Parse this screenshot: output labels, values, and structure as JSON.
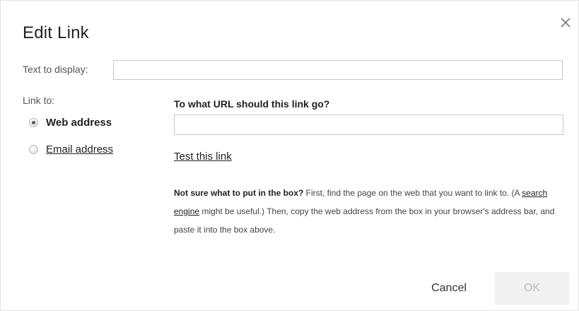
{
  "dialog": {
    "title": "Edit Link",
    "close_icon": "close-icon"
  },
  "text_to_display": {
    "label": "Text to display:",
    "value": ""
  },
  "link_to": {
    "label": "Link to:",
    "options": [
      {
        "label": "Web address",
        "selected": true
      },
      {
        "label": "Email address",
        "selected": false
      }
    ]
  },
  "url": {
    "heading": "To what URL should this link go?",
    "value": "",
    "test_link": "Test this link"
  },
  "help": {
    "bold": "Not sure what to put in the box?",
    "text1": " First, find the page on the web that you want to link to. (A ",
    "link": "search engine",
    "text2": " might be useful.) Then, copy the web address from the box in your browser's address bar, and paste it into the box above."
  },
  "buttons": {
    "cancel": "Cancel",
    "ok": "OK"
  },
  "colors": {
    "ok_disabled_bg": "#f1f1f1",
    "ok_disabled_text": "#bdbdbd",
    "border": "#c8c8c8"
  }
}
